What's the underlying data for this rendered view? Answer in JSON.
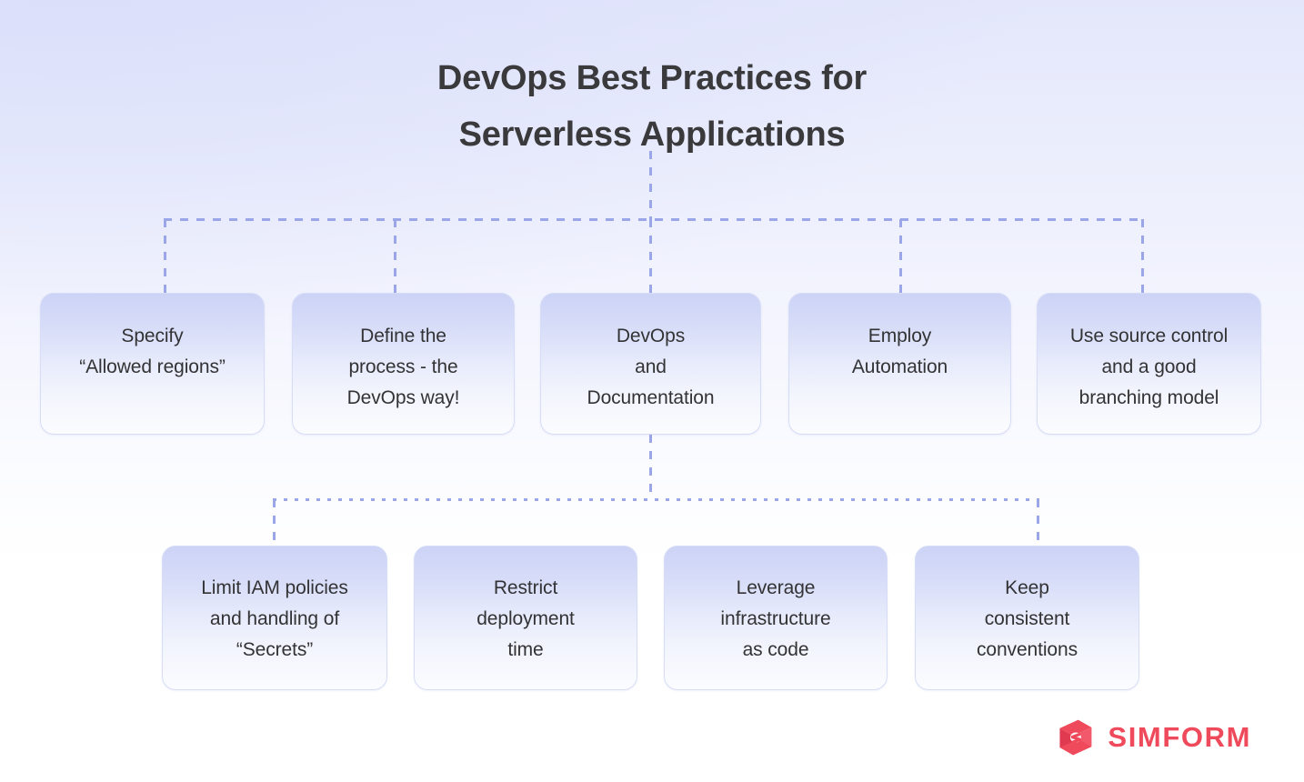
{
  "title": {
    "line1": "DevOps Best Practices for",
    "line2": "Serverless Applications",
    "color": "#3a3a3c"
  },
  "diagram_data": {
    "type": "tree-diagram",
    "orientation": "top-down",
    "connector_style": "dashed",
    "connector_color": "#9aa6e8",
    "node_fill_top": "#ccd3f6",
    "node_fill_bottom": "#fbfcff",
    "node_border": "#d7ddf7",
    "node_text_color": "#333335",
    "levels": [
      {
        "level": 1,
        "name": "root",
        "label": "DevOps Best Practices for Serverless Applications"
      },
      {
        "level": 2,
        "name": "primary-practices",
        "nodes": [
          {
            "id": "specify-allowed-regions",
            "label": "Specify\n“Allowed regions”"
          },
          {
            "id": "define-the-process",
            "label": "Define the\nprocess - the\nDevOps way!"
          },
          {
            "id": "devops-and-documentation",
            "label": "DevOps\nand\nDocumentation"
          },
          {
            "id": "employ-automation",
            "label": "Employ\nAutomation"
          },
          {
            "id": "use-source-control",
            "label": "Use source control\nand a good\nbranching model"
          }
        ]
      },
      {
        "level": 3,
        "name": "secondary-practices",
        "parent": "devops-and-documentation",
        "nodes": [
          {
            "id": "limit-iam-policies",
            "label": "Limit IAM policies\nand handling of\n“Secrets”"
          },
          {
            "id": "restrict-deployment-time",
            "label": "Restrict\ndeployment\ntime"
          },
          {
            "id": "leverage-infrastructure-as-code",
            "label": "Leverage\ninfrastructure\nas code"
          },
          {
            "id": "keep-consistent-conventions",
            "label": "Keep\nconsistent\nconventions"
          }
        ]
      }
    ]
  },
  "branding": {
    "logo_name": "simform-logo",
    "wordmark": "SIMFORM",
    "color": "#ef4a5c"
  }
}
